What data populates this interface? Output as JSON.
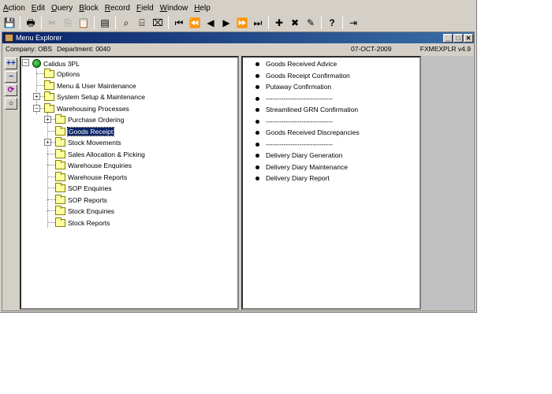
{
  "menubar": {
    "items": [
      {
        "label_m": "A",
        "label_r": "ction"
      },
      {
        "label_m": "E",
        "label_r": "dit"
      },
      {
        "label_m": "Q",
        "label_r": "uery"
      },
      {
        "label_m": "B",
        "label_r": "lock"
      },
      {
        "label_m": "R",
        "label_r": "ecord"
      },
      {
        "label_m": "F",
        "label_r": "ield"
      },
      {
        "label_m": "W",
        "label_r": "indow"
      },
      {
        "label_m": "H",
        "label_r": "elp"
      }
    ]
  },
  "toolbar": {
    "save_icon": "💾",
    "print_icon": "🖶",
    "cut_icon": "✂",
    "copy_icon": "⎘",
    "paste_icon": "📋",
    "clear_icon": "▤",
    "query1_icon": "⌕",
    "query2_icon": "⌸",
    "query3_icon": "⌧",
    "first_icon": "⏮",
    "prev_set_icon": "⏪",
    "prev_icon": "◀",
    "next_icon": "▶",
    "next_set_icon": "⏩",
    "last_icon": "⏭",
    "insert_icon": "✚",
    "delete_icon": "✖",
    "edit_icon": "✎",
    "help_icon": "?",
    "exit_icon": "⇥"
  },
  "window": {
    "title": "Menu Explorer",
    "min": "_",
    "max": "□",
    "close": "✕"
  },
  "info": {
    "company": "Company: OBS",
    "department": "Department: 0040",
    "date": "07-OCT-2009",
    "form": "FXMEXPLR  v4.9"
  },
  "sidetools": [
    "++",
    "−",
    "⟳",
    "○"
  ],
  "tree": {
    "root": "Calidus 3PL",
    "nodes": [
      {
        "label": "Options"
      },
      {
        "label": "Menu & User Maintenance"
      },
      {
        "label": "System Setup & Maintenance"
      },
      {
        "label": "Warehousing Processes"
      },
      {
        "label": "Purchase Ordering"
      },
      {
        "label": "Goods Receipt"
      },
      {
        "label": "Stock Movements"
      },
      {
        "label": "Sales Allocation & Picking"
      },
      {
        "label": "Warehouse Enquiries"
      },
      {
        "label": "Warehouse Reports"
      },
      {
        "label": "SOP Enquiries"
      },
      {
        "label": "SOP Reports"
      },
      {
        "label": "Stock Enquiries"
      },
      {
        "label": "Stock Reports"
      }
    ],
    "expand_plus": "+",
    "expand_minus": "−"
  },
  "list": {
    "items": [
      "Goods Received Advice",
      "Goods Receipt Confirmation",
      "Putaway Confirmation",
      "------------------------------",
      "Streamlined GRN Confirmation",
      "------------------------------",
      "Goods Received Discrepancies",
      "------------------------------",
      "Delivery Diary Generation",
      "Delivery Diary Maintenance",
      "Delivery Diary Report"
    ]
  }
}
